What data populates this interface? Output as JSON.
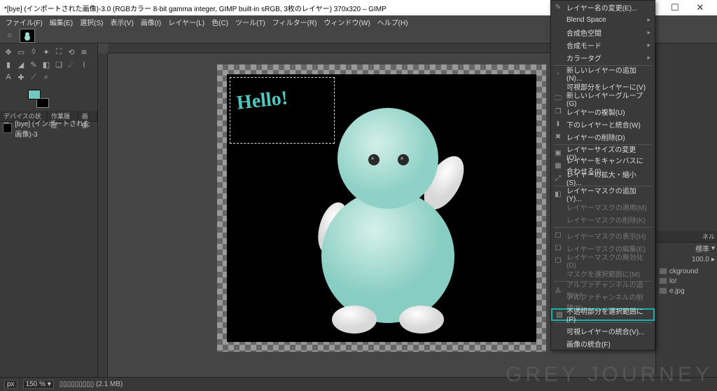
{
  "title": "*[bye] (インポートされた画像)-3.0 (RGBカラー 8-bit gamma integer, GIMP built-in sRGB, 3枚のレイヤー) 370x320 – GIMP",
  "menubar": {
    "file": "ファイル(F)",
    "edit": "編集(E)",
    "select": "選択(S)",
    "view": "表示(V)",
    "image": "画像(I)",
    "layer": "レイヤー(L)",
    "color": "色(C)",
    "tools": "ツール(T)",
    "filters": "フィルター(R)",
    "windows": "ウィンドウ(W)",
    "help": "ヘルプ(H)"
  },
  "left_tabs": {
    "device": "デバイスの状態",
    "history": "作業履歴",
    "image": "画像"
  },
  "layer_list": {
    "name": "[bye] (インポートされた画像)-3"
  },
  "hello_text": "Hello!",
  "right": {
    "panel_label": "ネル",
    "mode": "標準",
    "mode_arrow": "▾",
    "opacity": "100.0",
    "opacity_arrow": "▸",
    "item1": "ckground",
    "item2": "lo!",
    "item3": "e.jpg"
  },
  "context": {
    "rename": "レイヤー名の変更(E)...",
    "blend": "Blend Space",
    "compcolor": "合成色空間",
    "compmode": "合成モード",
    "colortag": "カラータグ",
    "newlayer": "新しいレイヤーの追加(N)...",
    "visible": "可視部分をレイヤーに(V)",
    "newgroup": "新しいレイヤーグループ(G)",
    "duplicate": "レイヤーの複製(U)",
    "mergedown": "下のレイヤーと統合(W)",
    "delete": "レイヤーの削除(D)",
    "resize": "レイヤーサイズの変更(O)...",
    "fitcanvas": "レイヤーをキャンバスに合わせる(I)",
    "scale": "レイヤーの拡大・縮小(S)...",
    "addmask": "レイヤーマスクの追加(Y)...",
    "applymask": "レイヤーマスクの適用(M)",
    "delmask": "レイヤーマスクの削除(K)",
    "showmask": "レイヤーマスクの表示(H)",
    "editmask": "レイヤーマスクの編集(E)",
    "disablemask": "レイヤーマスクの無効化(D)",
    "masktosel": "マスクを選択範囲に(M)",
    "addalpha": "アルファチャンネルの追加(H)",
    "delalpha": "アルファチャンネルの削除(R)",
    "alphatosel": "不透明部分を選択範囲に(P)",
    "mergev": "可視レイヤーの統合(V)...",
    "flatten": "画像の統合(F)"
  },
  "status": {
    "unit": "px",
    "zoom": "150 %",
    "arrow": "▾",
    "size": "(2.1 MB)"
  },
  "watermark": "GREY JOURNEY"
}
